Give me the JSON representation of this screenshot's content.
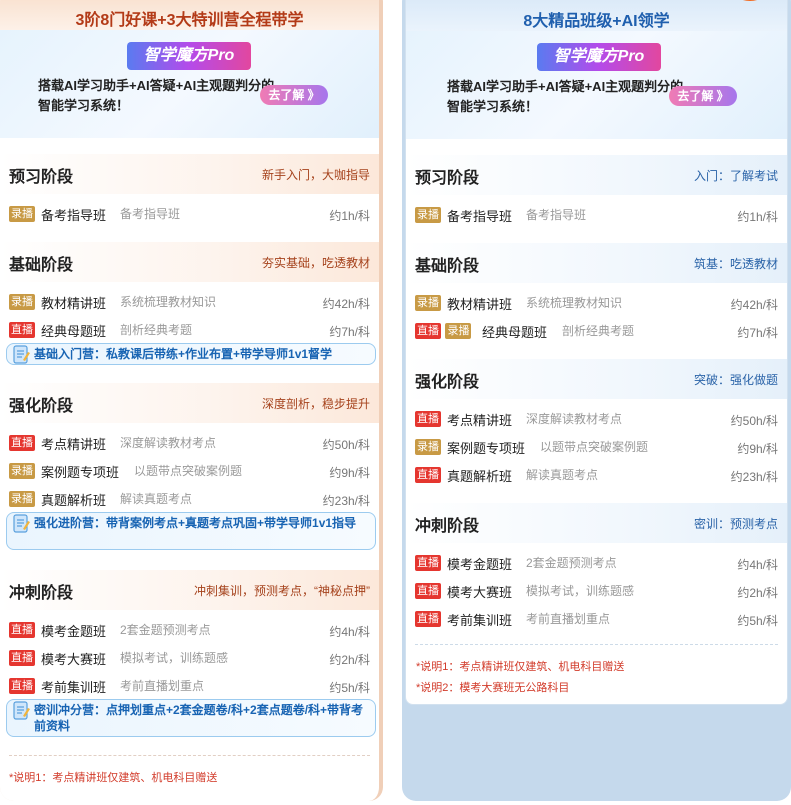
{
  "left": {
    "title": "3阶8门好课+3大特训营全程带学",
    "promo": {
      "pro_label": "智学魔方Pro",
      "text": "搭载AI学习助手+AI答疑+AI主观题判分的智能学习系统！",
      "button": "去了解 》"
    },
    "stages": [
      {
        "name": "预习阶段",
        "sub": "新手入门，大咖指导",
        "courses": [
          {
            "tags": [
              "录播"
            ],
            "name": "备考指导班",
            "desc": "备考指导班",
            "hours": "约1h/科"
          }
        ]
      },
      {
        "name": "基础阶段",
        "sub": "夯实基础，吃透教材",
        "courses": [
          {
            "tags": [
              "录播"
            ],
            "name": "教材精讲班",
            "desc": "系统梳理教材知识",
            "hours": "约42h/科"
          },
          {
            "tags": [
              "直播"
            ],
            "name": "经典母题班",
            "desc": "剖析经典考题",
            "hours": "约7h/科"
          }
        ],
        "camp": "基础入门营：私教课后带练+作业布置+带学导师1v1督学"
      },
      {
        "name": "强化阶段",
        "sub": "深度剖析，稳步提升",
        "courses": [
          {
            "tags": [
              "直播"
            ],
            "name": "考点精讲班",
            "desc": "深度解读教材考点",
            "hours": "约50h/科"
          },
          {
            "tags": [
              "录播"
            ],
            "name": "案例题专项班",
            "desc": "以题带点突破案例题",
            "hours": "约9h/科"
          },
          {
            "tags": [
              "录播"
            ],
            "name": "真题解析班",
            "desc": "解读真题考点",
            "hours": "约23h/科"
          }
        ],
        "camp": "强化进阶营：带背案例考点+真题考点巩固+带学导师1v1指导"
      },
      {
        "name": "冲刺阶段",
        "sub": "冲刺集训，预测考点，“神秘点押”",
        "courses": [
          {
            "tags": [
              "直播"
            ],
            "name": "模考金题班",
            "desc": "2套金题预测考点",
            "hours": "约4h/科"
          },
          {
            "tags": [
              "直播"
            ],
            "name": "模考大赛班",
            "desc": "模拟考试，训练题感",
            "hours": "约2h/科"
          },
          {
            "tags": [
              "直播"
            ],
            "name": "考前集训班",
            "desc": "考前直播划重点",
            "hours": "约5h/科"
          }
        ],
        "camp": "密训冲分营：点押划重点+2套金题卷/科+2套点题卷/科+带背考前资料"
      }
    ],
    "notes": [
      "*说明1：考点精讲班仅建筑、机电科目赠送"
    ]
  },
  "right": {
    "title": "8大精品班级+AI领学",
    "promo": {
      "pro_label": "智学魔方Pro",
      "text": "搭载AI学习助手+AI答疑+AI主观题判分的智能学习系统！",
      "button": "去了解 》"
    },
    "stages": [
      {
        "name": "预习阶段",
        "sub": "入门：了解考试",
        "courses": [
          {
            "tags": [
              "录播"
            ],
            "name": "备考指导班",
            "desc": "备考指导班",
            "hours": "约1h/科"
          }
        ]
      },
      {
        "name": "基础阶段",
        "sub": "筑基：吃透教材",
        "courses": [
          {
            "tags": [
              "录播"
            ],
            "name": "教材精讲班",
            "desc": "系统梳理教材知识",
            "hours": "约42h/科"
          },
          {
            "tags": [
              "直播",
              "录播"
            ],
            "name": "经典母题班",
            "desc": "剖析经典考题",
            "hours": "约7h/科"
          }
        ]
      },
      {
        "name": "强化阶段",
        "sub": "突破：强化做题",
        "courses": [
          {
            "tags": [
              "直播"
            ],
            "name": "考点精讲班",
            "desc": "深度解读教材考点",
            "hours": "约50h/科"
          },
          {
            "tags": [
              "录播"
            ],
            "name": "案例题专项班",
            "desc": "以题带点突破案例题",
            "hours": "约9h/科"
          },
          {
            "tags": [
              "直播"
            ],
            "name": "真题解析班",
            "desc": "解读真题考点",
            "hours": "约23h/科"
          }
        ]
      },
      {
        "name": "冲刺阶段",
        "sub": "密训：预测考点",
        "courses": [
          {
            "tags": [
              "直播"
            ],
            "name": "模考金题班",
            "desc": "2套金题预测考点",
            "hours": "约4h/科"
          },
          {
            "tags": [
              "直播"
            ],
            "name": "模考大赛班",
            "desc": "模拟考试，训练题感",
            "hours": "约2h/科"
          },
          {
            "tags": [
              "直播"
            ],
            "name": "考前集训班",
            "desc": "考前直播划重点",
            "hours": "约5h/科"
          }
        ]
      }
    ],
    "notes": [
      "*说明1：考点精讲班仅建筑、机电科目赠送",
      "*说明2：模考大赛班无公路科目"
    ]
  },
  "colors": {
    "live_tag": "#e5362f",
    "record_tag": "#c89a45",
    "camp_text": "#1864b3",
    "note": "#d23b2a"
  }
}
